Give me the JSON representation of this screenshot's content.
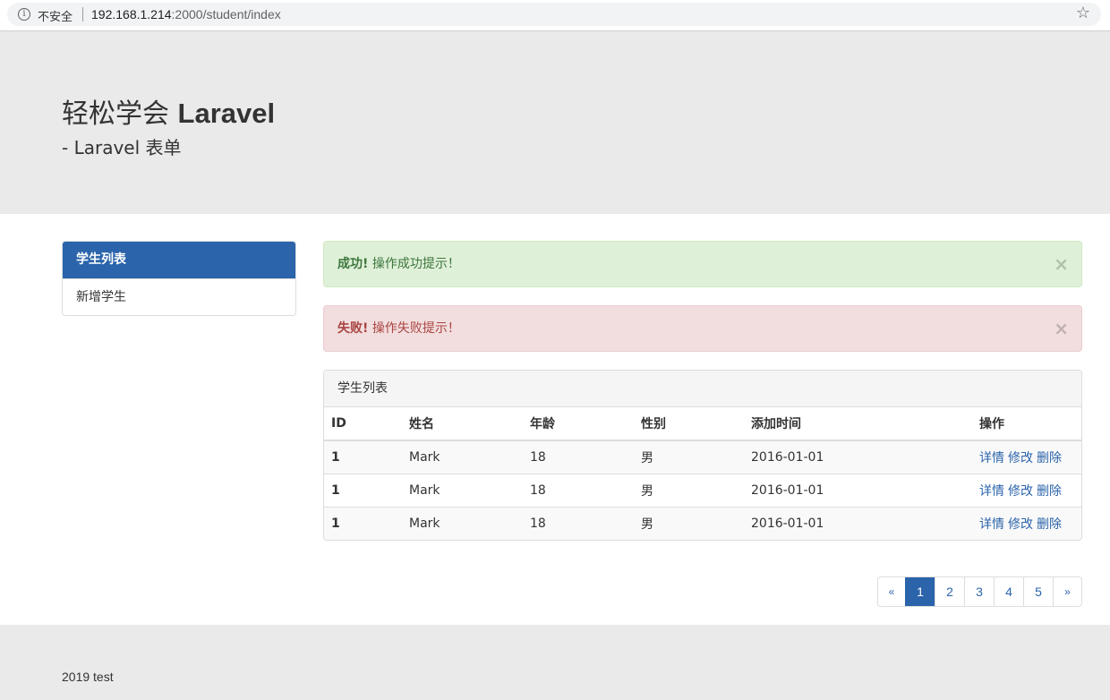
{
  "browser": {
    "security_label": "不安全",
    "url_host": "192.168.1.214",
    "url_rest": ":2000/student/index"
  },
  "jumbotron": {
    "title_prefix": "轻松学会 ",
    "title_bold": "Laravel",
    "subtitle": "- Laravel 表单"
  },
  "sidebar": {
    "items": [
      {
        "label": "学生列表",
        "active": true
      },
      {
        "label": "新增学生",
        "active": false
      }
    ]
  },
  "alerts": {
    "success": {
      "strong": "成功!",
      "text": " 操作成功提示！"
    },
    "danger": {
      "strong": "失败!",
      "text": " 操作失败提示！"
    },
    "close_glyph": "×"
  },
  "panel": {
    "heading": "学生列表",
    "columns": [
      "ID",
      "姓名",
      "年龄",
      "性别",
      "添加时间",
      "操作"
    ],
    "rows": [
      {
        "id": "1",
        "name": "Mark",
        "age": "18",
        "sex": "男",
        "created": "2016-01-01"
      },
      {
        "id": "1",
        "name": "Mark",
        "age": "18",
        "sex": "男",
        "created": "2016-01-01"
      },
      {
        "id": "1",
        "name": "Mark",
        "age": "18",
        "sex": "男",
        "created": "2016-01-01"
      }
    ],
    "actions": {
      "detail": "详情",
      "edit": "修改",
      "delete": "删除"
    }
  },
  "pagination": {
    "prev": "«",
    "pages": [
      "1",
      "2",
      "3",
      "4",
      "5"
    ],
    "active_page": "1",
    "next": "»"
  },
  "footer": {
    "text": "2019 test"
  },
  "colors": {
    "primary": "#2b64ab",
    "success_bg": "#dff0d8",
    "danger_bg": "#f2dede",
    "jumbotron_bg": "#eaeaea"
  }
}
